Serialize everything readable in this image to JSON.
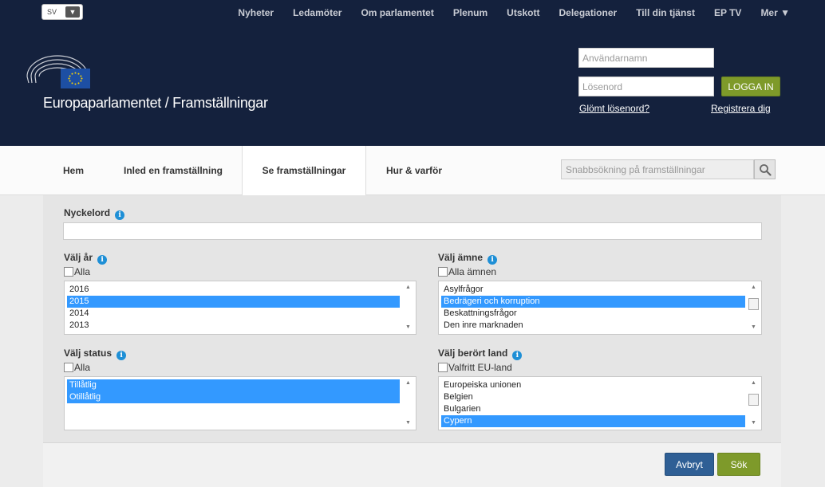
{
  "header": {
    "language": "SV",
    "site_title": "Europaparlamentet / Framställningar",
    "top_nav": [
      "Nyheter",
      "Ledamöter",
      "Om parlamentet",
      "Plenum",
      "Utskott",
      "Delegationer",
      "Till din tjänst",
      "EP TV",
      "Mer ▼"
    ],
    "login": {
      "username_placeholder": "Användarnamn",
      "password_placeholder": "Lösenord",
      "login_button": "LOGGA IN",
      "forgot_password": "Glömt lösenord?",
      "register": "Registrera dig"
    }
  },
  "main_nav": {
    "tabs": [
      "Hem",
      "Inled en framställning",
      "Se framställningar",
      "Hur & varför"
    ],
    "active_tab": "Se framställningar",
    "quick_search_placeholder": "Snabbsökning på framställningar"
  },
  "form": {
    "keyword": {
      "label": "Nyckelord",
      "value": ""
    },
    "year": {
      "label": "Välj år",
      "all_label": "Alla",
      "options": [
        "2016",
        "2015",
        "2014",
        "2013"
      ],
      "selected": [
        "2015"
      ]
    },
    "subject": {
      "label": "Välj ämne",
      "all_label": "Alla ämnen",
      "options": [
        "Asylfrågor",
        "Bedrägeri och korruption",
        "Beskattningsfrågor",
        "Den inre marknaden"
      ],
      "selected": [
        "Bedrägeri och korruption"
      ]
    },
    "status": {
      "label": "Välj status",
      "all_label": "Alla",
      "options": [
        "Tillåtlig",
        "Otillåtlig"
      ],
      "selected": [
        "Tillåtlig",
        "Otillåtlig"
      ]
    },
    "country": {
      "label": "Välj berört land",
      "all_label": "Valfritt EU-land",
      "options": [
        "Europeiska unionen",
        "Belgien",
        "Bulgarien",
        "Cypern"
      ],
      "selected": [
        "Cypern"
      ]
    },
    "cancel_button": "Avbryt",
    "search_button": "Sök"
  },
  "colors": {
    "header_bg": "#14213d",
    "accent_green": "#7e9a2a",
    "accent_blue": "#2f5f95",
    "selection": "#3399ff",
    "info_icon": "#1e8fd6"
  }
}
